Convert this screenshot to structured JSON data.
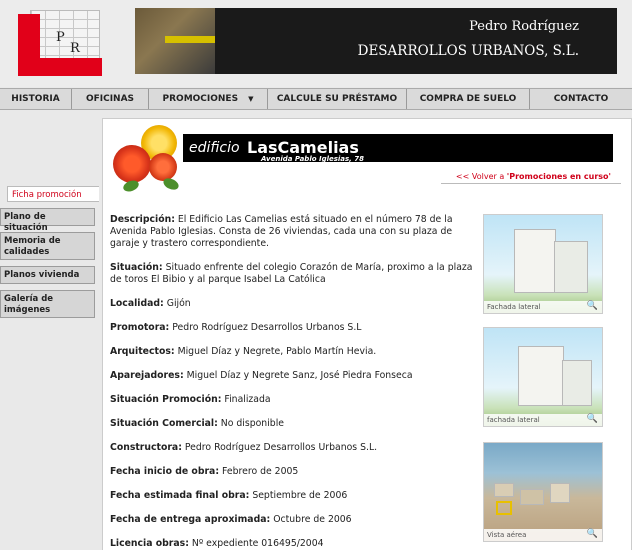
{
  "header": {
    "logo_letters": [
      "P",
      "R"
    ],
    "name": "Pedro Rodríguez",
    "company": "DESARROLLOS URBANOS, S.L."
  },
  "nav": [
    {
      "label": "HISTORIA",
      "w": 0
    },
    {
      "label": "OFICINAS"
    },
    {
      "label": "PROMOCIONES",
      "dropdown": true
    },
    {
      "label": "CALCULE SU PRÉSTAMO"
    },
    {
      "label": "COMPRA DE SUELO"
    },
    {
      "label": "CONTACTO"
    }
  ],
  "sidebar": {
    "active": "Ficha promoción",
    "items": [
      "Plano de situación",
      "Memoria de calidades",
      "Planos vivienda",
      "Galería de imágenes"
    ]
  },
  "page": {
    "edificio": "edificio",
    "name": "LasCamelias",
    "address": "Avenida Pablo Iglesias, 78",
    "back_prefix": "<< ",
    "back_text": "Volver a ",
    "back_target": "'Promociones en curso'"
  },
  "details": [
    {
      "label": "Descripción:",
      "value": "El Edificio Las Camelias está situado en el número 78 de la Avenida Pablo Iglesias. Consta de 26 viviendas, cada una con su plaza de garaje y trastero correspondiente."
    },
    {
      "label": "Situación:",
      "value": "Situado enfrente del colegio Corazón de María, proximo a la plaza de toros El Bibio y al parque Isabel La Católica"
    },
    {
      "label": "Localidad:",
      "value": "Gijón"
    },
    {
      "label": "Promotora:",
      "value": "Pedro Rodríguez Desarrollos Urbanos S.L"
    },
    {
      "label": "Arquitectos:",
      "value": "Miguel Díaz y Negrete, Pablo Martín Hevia."
    },
    {
      "label": "Aparejadores:",
      "value": "Miguel Díaz y Negrete Sanz, José Piedra Fonseca"
    },
    {
      "label": "Situación Promoción:",
      "value": "Finalizada"
    },
    {
      "label": "Situación Comercial:",
      "value": "No disponible"
    },
    {
      "label": "Constructora:",
      "value": "Pedro Rodríguez Desarrollos Urbanos S.L."
    },
    {
      "label": "Fecha inicio de obra:",
      "value": "Febrero de 2005"
    },
    {
      "label": "Fecha estimada final obra:",
      "value": "Septiembre de 2006"
    },
    {
      "label": "Fecha de entrega aproximada:",
      "value": "Octubre de 2006"
    },
    {
      "label": "Licencia obras:",
      "value": "Nº expediente 016495/2004"
    }
  ],
  "thumbs": [
    {
      "caption": "Fachada lateral"
    },
    {
      "caption": "fachada lateral"
    },
    {
      "caption": "Vista aérea"
    }
  ],
  "zoom_icon": "magnifier-icon"
}
